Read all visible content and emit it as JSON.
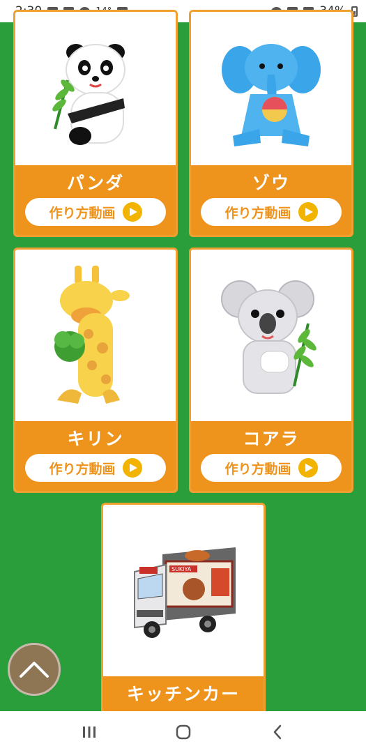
{
  "status_bar": {
    "time": "2:30",
    "temperature": "14°",
    "battery": "34%"
  },
  "cards": [
    {
      "name": "パンダ",
      "video_label": "作り方動画",
      "toy": "panda"
    },
    {
      "name": "ゾウ",
      "video_label": "作り方動画",
      "toy": "elephant"
    },
    {
      "name": "キリン",
      "video_label": "作り方動画",
      "toy": "giraffe"
    },
    {
      "name": "コアラ",
      "video_label": "作り方動画",
      "toy": "koala"
    },
    {
      "name": "キッチンカー",
      "toy": "kitchen-car"
    }
  ],
  "truck_sign": "SUKIYA",
  "icons": {
    "back_to_top": "chevron-up-icon",
    "nav_recent": "recent-apps-icon",
    "nav_home": "home-icon",
    "nav_back": "back-icon"
  },
  "colors": {
    "background": "#2a9e3a",
    "card_accent": "#ee931c",
    "play": "#f2b400"
  }
}
